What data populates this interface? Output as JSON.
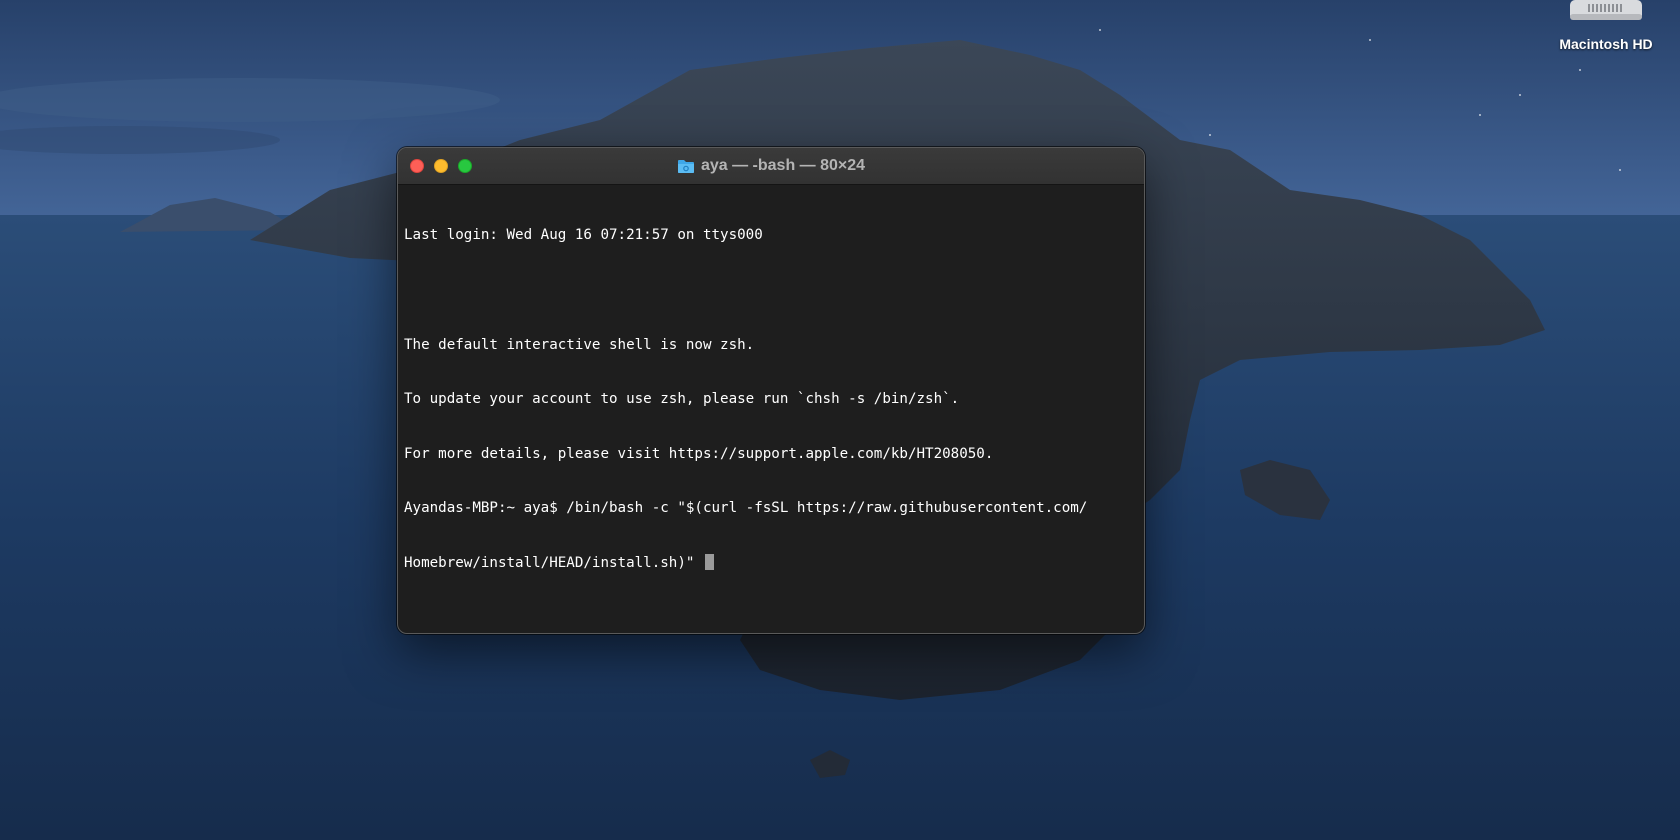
{
  "desktop": {
    "icons": [
      {
        "label": "Macintosh HD",
        "icon": "hard-drive-icon"
      }
    ]
  },
  "terminal": {
    "title": "aya — -bash — 80×24",
    "title_icon": "folder-icon",
    "lines": [
      "Last login: Wed Aug 16 07:21:57 on ttys000",
      "",
      "The default interactive shell is now zsh.",
      "To update your account to use zsh, please run `chsh -s /bin/zsh`.",
      "For more details, please visit https://support.apple.com/kb/HT208050.",
      "Ayandas-MBP:~ aya$ /bin/bash -c \"$(curl -fsSL https://raw.githubusercontent.com/",
      "Homebrew/install/HEAD/install.sh)\" "
    ]
  },
  "colors": {
    "terminal_bg": "#1e1e1e",
    "close": "#fe5f57",
    "minimize": "#febc2e",
    "maximize": "#28c840"
  }
}
